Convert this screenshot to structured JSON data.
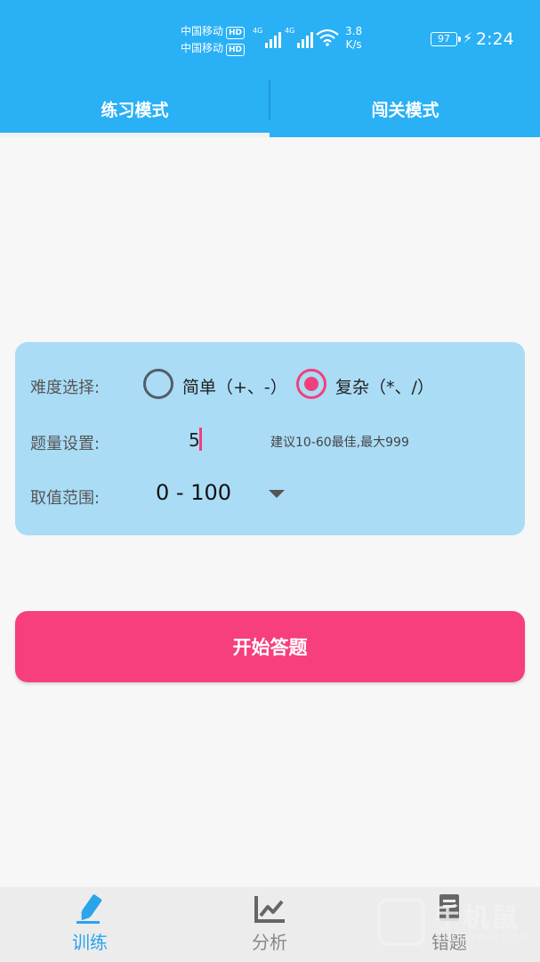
{
  "status_bar": {
    "carrier1": "中国移动",
    "carrier2": "中国移动",
    "hd_badge": "HD",
    "network1": "4G",
    "network2": "4G",
    "speed_value": "3.8",
    "speed_unit": "K/s",
    "battery": "97",
    "time": "2:24"
  },
  "tabs": [
    {
      "label": "练习模式",
      "active": true
    },
    {
      "label": "闯关模式",
      "active": false
    }
  ],
  "settings": {
    "difficulty_label": "难度选择:",
    "option_simple": "简单（+、-）",
    "option_complex": "复杂（*、/）",
    "selected": "complex",
    "quantity_label": "题量设置:",
    "quantity_value": "5",
    "quantity_hint": "建议10-60最佳,最大999",
    "range_label": "取值范围:",
    "range_value": "0 - 100"
  },
  "start_button": "开始答题",
  "bottom_nav": [
    {
      "label": "训练",
      "icon": "pencil-icon",
      "active": true
    },
    {
      "label": "分析",
      "icon": "line-chart-icon",
      "active": false
    },
    {
      "label": "错题",
      "icon": "notebook-icon",
      "active": false
    }
  ],
  "watermark": {
    "text": "手机鼠",
    "sub": "SHOUJISHU.COM"
  },
  "colors": {
    "primary": "#29b0f5",
    "accent": "#f63f7c",
    "card": "#aadcf6",
    "nav_active": "#2aa4ea"
  }
}
